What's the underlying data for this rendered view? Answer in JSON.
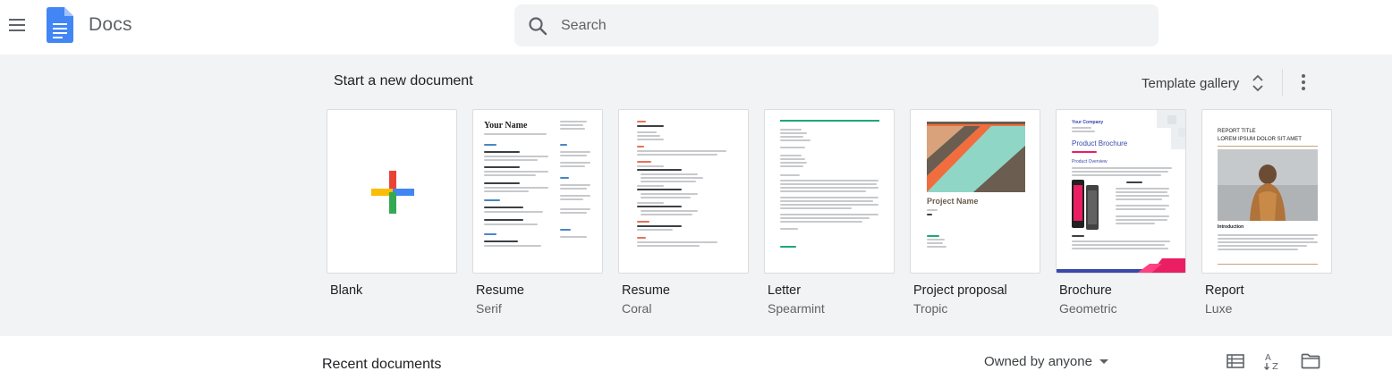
{
  "header": {
    "app_title": "Docs",
    "search_placeholder": "Search",
    "icons": [
      "menu-icon",
      "docs-logo-icon",
      "search-icon"
    ]
  },
  "templates_section": {
    "title": "Start a new document",
    "gallery_label": "Template gallery",
    "templates": [
      {
        "name": "Blank",
        "subtitle": ""
      },
      {
        "name": "Resume",
        "subtitle": "Serif",
        "heading": "Your Name"
      },
      {
        "name": "Resume",
        "subtitle": "Coral"
      },
      {
        "name": "Letter",
        "subtitle": "Spearmint"
      },
      {
        "name": "Project proposal",
        "subtitle": "Tropic",
        "heading": "Project Name"
      },
      {
        "name": "Brochure",
        "subtitle": "Geometric",
        "heading": "Product Brochure",
        "company": "Your Company",
        "overview": "Product Overview"
      },
      {
        "name": "Report",
        "subtitle": "Luxe",
        "heading": "REPORT TITLE",
        "subheading": "LOREM IPSUM DOLOR SIT AMET",
        "intro": "Introduction"
      }
    ]
  },
  "recent": {
    "title": "Recent documents",
    "owner_filter": "Owned by anyone",
    "icons": [
      "list-view-icon",
      "sort-az-icon",
      "folder-icon"
    ]
  },
  "colors": {
    "band_bg": "#f1f3f4",
    "docs_blue": "#4285f4",
    "plus_red": "#ea4335",
    "plus_yellow": "#fbbc04",
    "plus_green": "#34a853"
  }
}
